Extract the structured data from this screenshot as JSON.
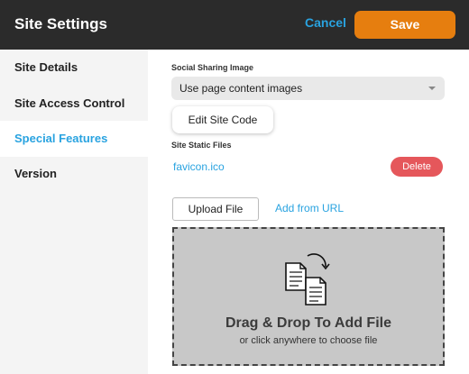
{
  "header": {
    "title": "Site Settings",
    "cancel_label": "Cancel",
    "save_label": "Save"
  },
  "sidebar": {
    "items": [
      {
        "label": "Site Details",
        "active": false
      },
      {
        "label": "Site Access Control",
        "active": false
      },
      {
        "label": "Special Features",
        "active": true
      },
      {
        "label": "Version",
        "active": false
      }
    ]
  },
  "main": {
    "social_sharing_label": "Social Sharing Image",
    "social_sharing_value": "Use page content images",
    "edit_site_code_label": "Edit Site Code",
    "static_files_label": "Site Static Files",
    "files": [
      {
        "name": "favicon.ico",
        "delete_label": "Delete"
      }
    ],
    "upload_file_label": "Upload File",
    "add_from_url_label": "Add from URL",
    "dropzone": {
      "title": "Drag & Drop To Add File",
      "subtitle": "or click anywhere to choose file"
    }
  },
  "colors": {
    "accent": "#29a3e0",
    "save": "#e67e0f",
    "delete": "#e5575b",
    "header_bg": "#2b2b2b"
  },
  "icons": {
    "dropzone_icon": "document-copy-icon"
  }
}
